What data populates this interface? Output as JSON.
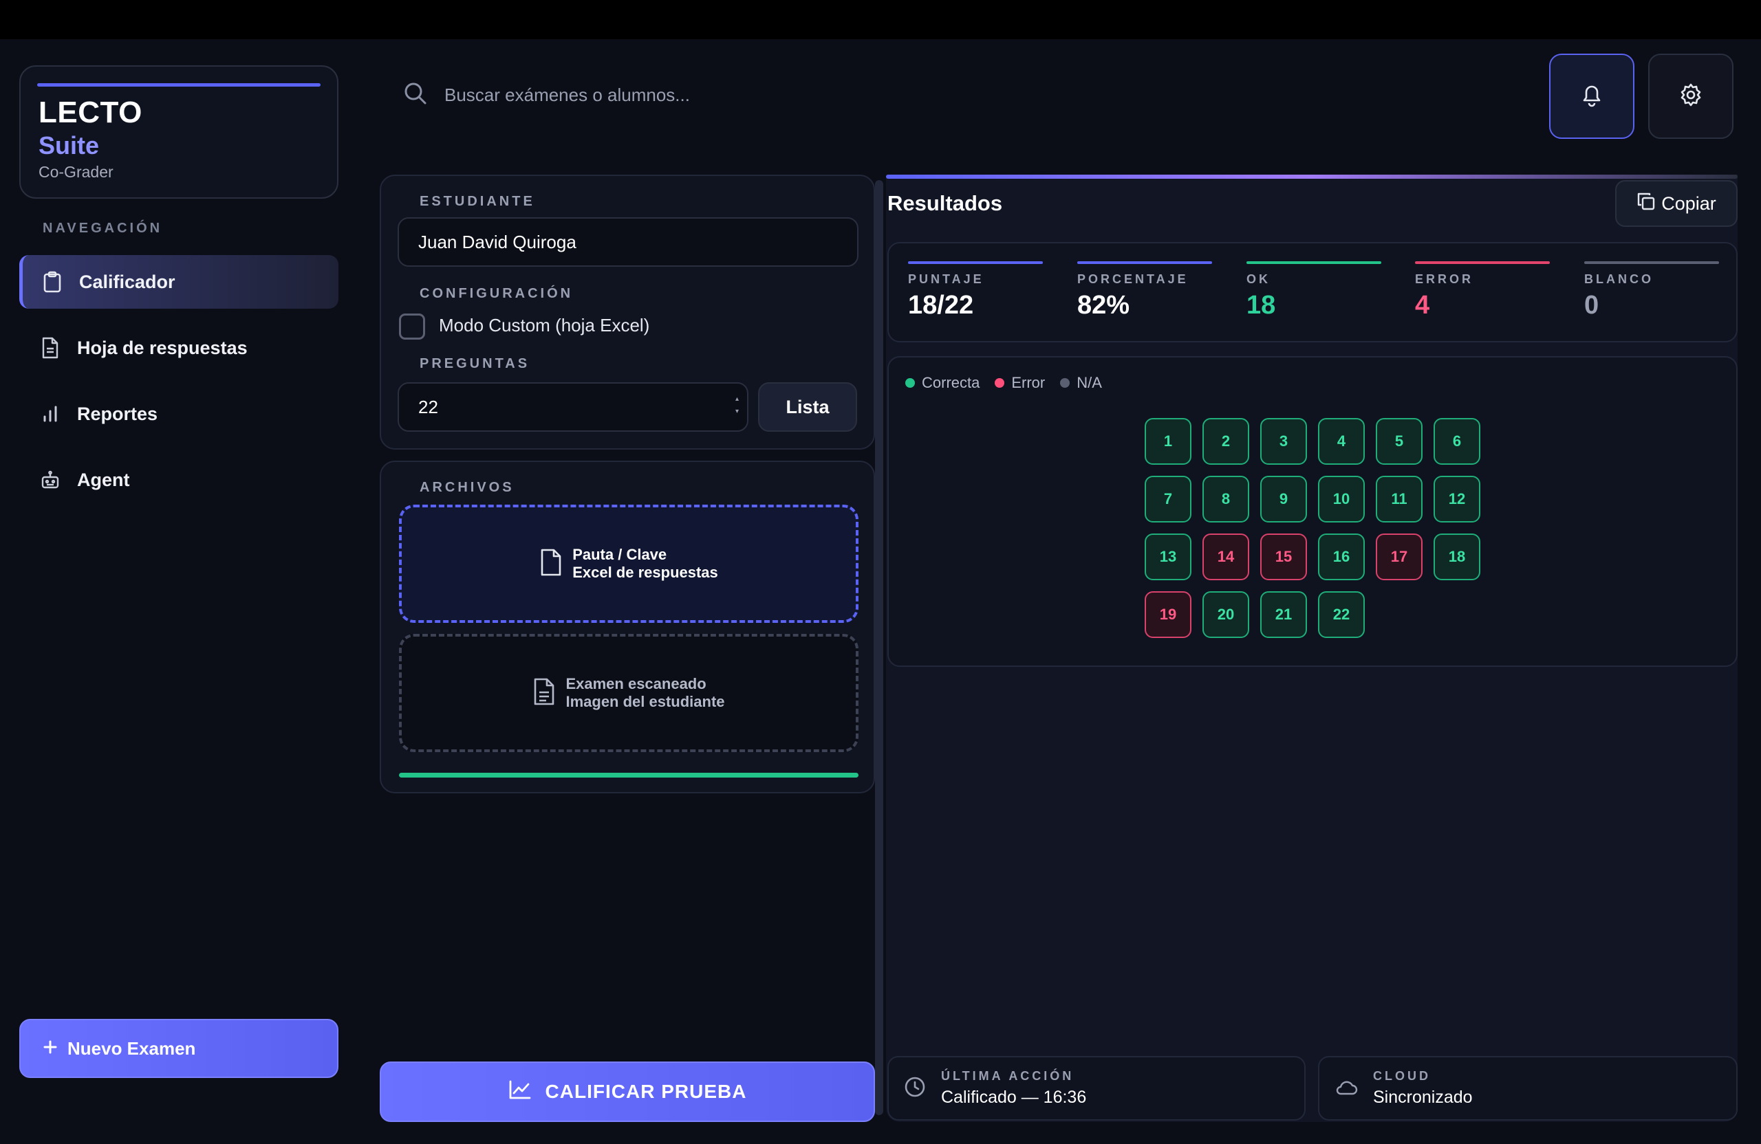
{
  "brand": {
    "name": "LECTO",
    "suite": "Suite",
    "subtitle": "Co-Grader"
  },
  "sidebar": {
    "section_title": "NAVEGACIÓN",
    "items": [
      {
        "label": "Calificador",
        "icon": "clipboard-icon",
        "active": true
      },
      {
        "label": "Hoja de respuestas",
        "icon": "document-icon",
        "active": false
      },
      {
        "label": "Reportes",
        "icon": "bar-chart-icon",
        "active": false
      },
      {
        "label": "Agent",
        "icon": "robot-icon",
        "active": false
      }
    ],
    "new_exam_label": "Nuevo Examen"
  },
  "header": {
    "search_placeholder": "Buscar exámenes o alumnos..."
  },
  "form": {
    "student_label": "ESTUDIANTE",
    "student_value": "Juan David Quiroga",
    "config_label": "CONFIGURACIÓN",
    "custom_mode_label": "Modo Custom (hoja Excel)",
    "custom_mode_checked": false,
    "questions_label": "PREGUNTAS",
    "questions_value": "22",
    "list_button": "Lista"
  },
  "files": {
    "section_label": "ARCHIVOS",
    "key_title": "Pauta / Clave",
    "key_subtitle": "Excel de respuestas",
    "scan_title": "Examen escaneado",
    "scan_subtitle": "Imagen del estudiante",
    "progress": 1.0
  },
  "grade_button": "CALIFICAR PRUEBA",
  "results": {
    "title": "Resultados",
    "copy_label": "Copiar",
    "stats": [
      {
        "label": "PUNTAJE",
        "value": "18/22",
        "color": "#ffffff",
        "line": "#5b63f5"
      },
      {
        "label": "PORCENTAJE",
        "value": "82%",
        "color": "#ffffff",
        "line": "#5b63f5"
      },
      {
        "label": "OK",
        "value": "18",
        "color": "#2fd29a",
        "line": "#22c48a"
      },
      {
        "label": "ERROR",
        "value": "4",
        "color": "#ff5a85",
        "line": "#e2446c"
      },
      {
        "label": "BLANCO",
        "value": "0",
        "color": "#9aa0b2",
        "line": "#5a6072"
      }
    ],
    "legend": [
      {
        "label": "Correcta",
        "color": "#22c48a"
      },
      {
        "label": "Error",
        "color": "#ff4f7b"
      },
      {
        "label": "N/A",
        "color": "#5a6072"
      }
    ],
    "questions": [
      {
        "n": "1",
        "status": "ok"
      },
      {
        "n": "2",
        "status": "ok"
      },
      {
        "n": "3",
        "status": "ok"
      },
      {
        "n": "4",
        "status": "ok"
      },
      {
        "n": "5",
        "status": "ok"
      },
      {
        "n": "6",
        "status": "ok"
      },
      {
        "n": "7",
        "status": "ok"
      },
      {
        "n": "8",
        "status": "ok"
      },
      {
        "n": "9",
        "status": "ok"
      },
      {
        "n": "10",
        "status": "ok"
      },
      {
        "n": "11",
        "status": "ok"
      },
      {
        "n": "12",
        "status": "ok"
      },
      {
        "n": "13",
        "status": "ok"
      },
      {
        "n": "14",
        "status": "err"
      },
      {
        "n": "15",
        "status": "err"
      },
      {
        "n": "16",
        "status": "ok"
      },
      {
        "n": "17",
        "status": "err"
      },
      {
        "n": "18",
        "status": "ok"
      },
      {
        "n": "19",
        "status": "err"
      },
      {
        "n": "20",
        "status": "ok"
      },
      {
        "n": "21",
        "status": "ok"
      },
      {
        "n": "22",
        "status": "ok"
      }
    ]
  },
  "footer": {
    "last_action_label": "ÚLTIMA ACCIÓN",
    "last_action_value": "Calificado — 16:36",
    "cloud_label": "CLOUD",
    "cloud_value": "Sincronizado"
  }
}
